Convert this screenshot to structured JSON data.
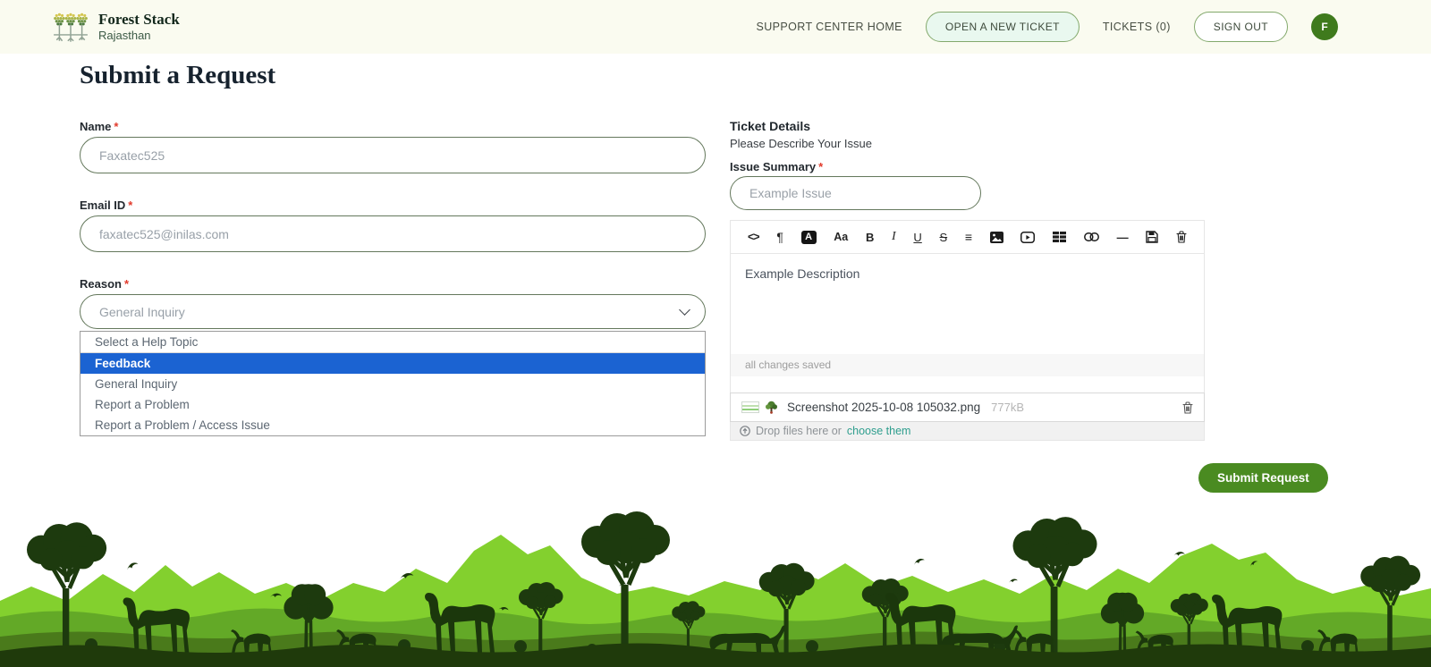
{
  "header": {
    "brand": {
      "title": "Forest Stack",
      "subtitle": "Rajasthan"
    },
    "nav": {
      "home": "SUPPORT CENTER HOME",
      "open_ticket": "OPEN A NEW TICKET",
      "tickets": "TICKETS (0)",
      "sign_out": "SIGN OUT",
      "avatar_initial": "F"
    }
  },
  "page": {
    "title": "Submit a Request"
  },
  "form": {
    "name": {
      "label": "Name",
      "required_mark": "*",
      "value": "Faxatec525"
    },
    "email": {
      "label": "Email ID",
      "required_mark": "*",
      "value": "faxatec525@inilas.com"
    },
    "reason": {
      "label": "Reason",
      "required_mark": "*",
      "selected": "General Inquiry",
      "options": [
        "Select a Help Topic",
        "Feedback",
        "General Inquiry",
        "Report a Problem",
        "Report a Problem / Access Issue"
      ],
      "highlighted_option": "Feedback"
    }
  },
  "ticket": {
    "title": "Ticket Details",
    "subtitle": "Please Describe Your Issue",
    "summary": {
      "label": "Issue Summary",
      "required_mark": "*",
      "placeholder": "Example Issue"
    },
    "editor": {
      "placeholder": "Example Description",
      "status": "all changes saved",
      "toolbar": [
        {
          "name": "code-icon",
          "glyph": "<>"
        },
        {
          "name": "paragraph-icon",
          "glyph": "¶"
        },
        {
          "name": "font-color-icon",
          "glyph": "A"
        },
        {
          "name": "font-size-icon",
          "glyph": "Aa"
        },
        {
          "name": "bold-icon",
          "glyph": "B"
        },
        {
          "name": "italic-icon",
          "glyph": "I"
        },
        {
          "name": "underline-icon",
          "glyph": "U"
        },
        {
          "name": "strikethrough-icon",
          "glyph": "S"
        },
        {
          "name": "bullet-list-icon",
          "glyph": "≡"
        },
        {
          "name": "insert-image-icon",
          "glyph": ""
        },
        {
          "name": "insert-video-icon",
          "glyph": ""
        },
        {
          "name": "insert-table-icon",
          "glyph": ""
        },
        {
          "name": "insert-link-icon",
          "glyph": ""
        },
        {
          "name": "horizontal-rule-icon",
          "glyph": "—"
        },
        {
          "name": "save-icon",
          "glyph": ""
        },
        {
          "name": "trash-icon",
          "glyph": ""
        }
      ]
    },
    "attachment": {
      "filename": "Screenshot 2025-10-08 105032.png",
      "size": "777kB"
    },
    "dropzone": {
      "text": "Drop files here or",
      "link": "choose them"
    },
    "submit_label": "Submit Request"
  },
  "colors": {
    "accent_green": "#4a8b21",
    "header_bg": "#fafbf0",
    "highlight_blue": "#1b63d2",
    "link_teal": "#2f9e8e",
    "footer_bright_green": "#83d02e",
    "footer_mid_green": "#63a927",
    "footer_olive": "#4a7a1b",
    "footer_dark": "#1f3a0b"
  }
}
